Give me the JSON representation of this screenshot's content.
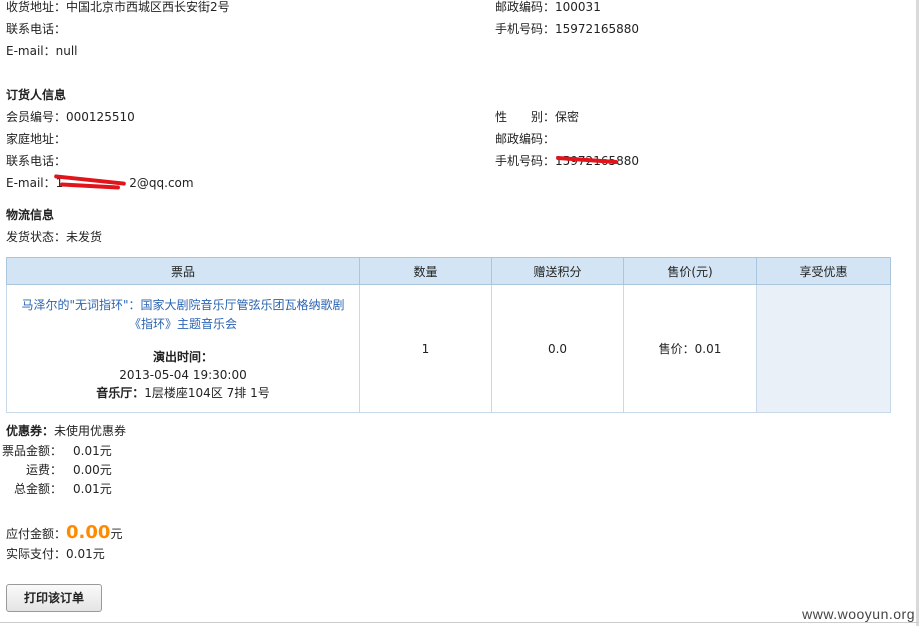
{
  "shipping": {
    "address_label": "收货地址：",
    "address_value": "中国北京市西城区西长安街2号",
    "postcode_label": "邮政编码：",
    "postcode_value": "100031",
    "phone_label": "联系电话：",
    "phone_value": "",
    "mobile_label": "手机号码：",
    "mobile_value": "15972165880",
    "email_label": "E-mail：",
    "email_value": "null"
  },
  "orderer": {
    "title": "订货人信息",
    "member_label": "会员编号：",
    "member_value": "000125510",
    "gender_label": "性　　别：",
    "gender_value": "保密",
    "home_label": "家庭地址：",
    "home_value": "",
    "postcode_label": "邮政编码：",
    "postcode_value": "",
    "phone_label": "联系电话：",
    "phone_value": "",
    "mobile_label": "手机号码：",
    "mobile_value": "15972165880",
    "email_label": "E-mail：",
    "email_value_prefix": "1",
    "email_value_suffix": "2@qq.com"
  },
  "logistics": {
    "title": "物流信息",
    "status_label": "发货状态：",
    "status_value": "未发货"
  },
  "table": {
    "headers": [
      "票品",
      "数量",
      "赠送积分",
      "售价(元)",
      "享受优惠"
    ],
    "row": {
      "product_title": "马泽尔的\"无词指环\"：国家大剧院音乐厅管弦乐团瓦格纳歌剧《指环》主题音乐会",
      "showtime_label": "演出时间：",
      "showtime_value": "2013-05-04 19:30:00",
      "hall_label": "音乐厅：",
      "hall_value": "1层楼座104区 7排 1号",
      "quantity": "1",
      "points": "0.0",
      "price": "售价：0.01",
      "discount": ""
    }
  },
  "summary": {
    "coupon_label": "优惠券：",
    "coupon_value": "未使用优惠券",
    "ticket_amount_label": "票品金额：",
    "ticket_amount_value": "0.01元",
    "shipping_fee_label": "运费：",
    "shipping_fee_value": "0.00元",
    "total_label": "总金额：",
    "total_value": "0.01元",
    "payable_label": "应付金额：",
    "payable_value": "0.00",
    "payable_unit": "元",
    "paid_label": "实际支付：",
    "paid_value": "0.01元"
  },
  "actions": {
    "print_label": "打印该订单"
  },
  "watermark": "www.wooyun.org",
  "colors": {
    "accent_orange": "#ff8a00",
    "link_blue": "#2b64b3",
    "table_header_bg": "#d3e5f4",
    "redaction_red": "#e0141a"
  }
}
